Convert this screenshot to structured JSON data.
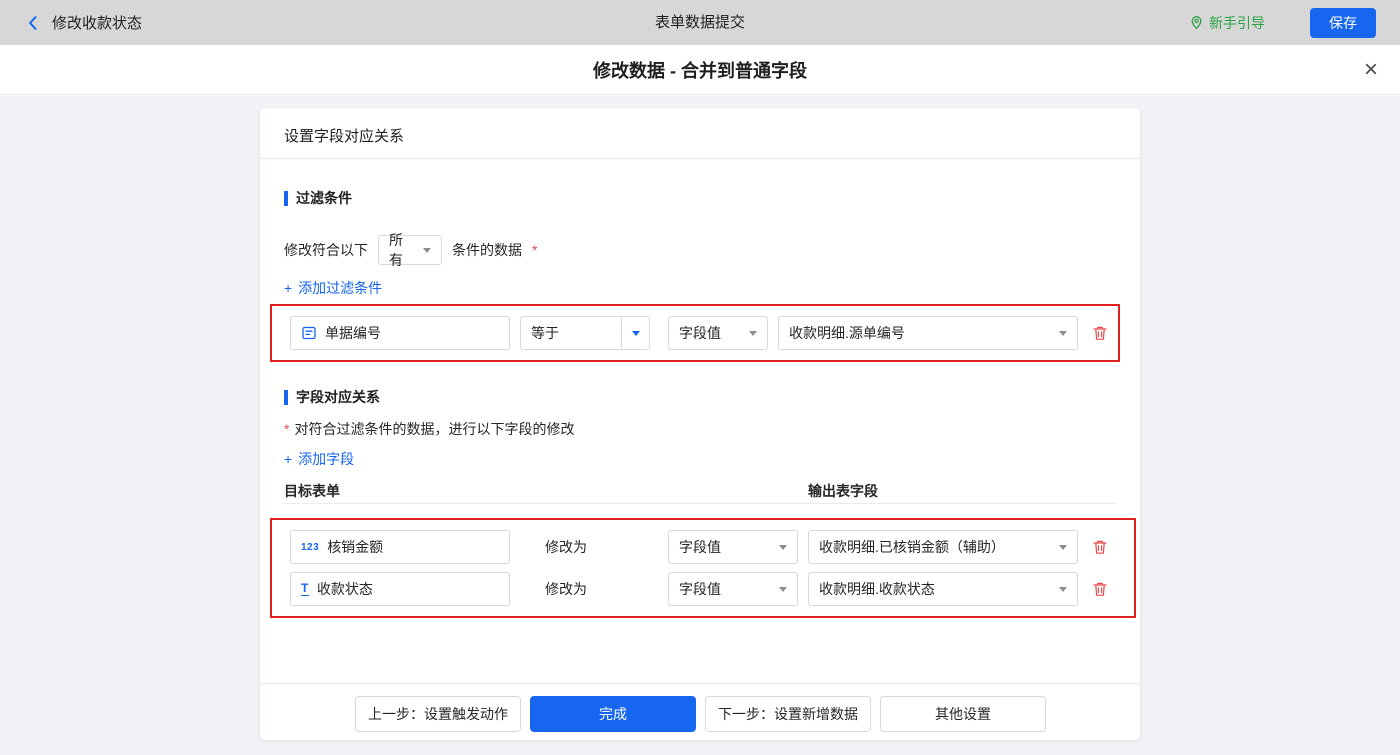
{
  "colors": {
    "accent_blue": "#1766f0",
    "annotation_red": "#e0201f",
    "danger_red": "#e5484d",
    "guide_green": "#2ba245",
    "topbar_gray": "#d7d7d7"
  },
  "icons": {
    "back": "chevron-left",
    "guide": "location-pin",
    "close": "×",
    "plus": "+",
    "delete": "trash",
    "number_field_glyph": "123",
    "text_field_glyph": "T",
    "lookup_field": "form-sheet"
  },
  "topbar": {
    "back_label": "修改收款状态",
    "title": "表单数据提交",
    "guide_label": "新手引导",
    "save_label": "保存"
  },
  "dialog": {
    "title": "修改数据 - 合并到普通字段"
  },
  "card": {
    "header": "设置字段对应关系",
    "filter": {
      "section_title": "过滤条件",
      "match_prefix": "修改符合以下",
      "match_mode": "所有",
      "match_suffix": "条件的数据",
      "required_mark": "*",
      "add_label": "添加过滤条件",
      "row": {
        "field": "单据编号",
        "operator": "等于",
        "value_type": "字段值",
        "value": "收款明细.源单编号"
      }
    },
    "mapping": {
      "section_title": "字段对应关系",
      "required_mark": "*",
      "description": "对符合过滤条件的数据，进行以下字段的修改",
      "add_label": "添加字段",
      "columns": {
        "target": "目标表单",
        "output": "输出表字段"
      },
      "action_label": "修改为",
      "rows": [
        {
          "icon": "123",
          "field": "核销金额",
          "value_type": "字段值",
          "value": "收款明细.已核销金额（辅助）"
        },
        {
          "icon": "T",
          "field": "收款状态",
          "value_type": "字段值",
          "value": "收款明细.收款状态"
        }
      ]
    },
    "footer": {
      "prev": "上一步：设置触发动作",
      "done": "完成",
      "next": "下一步：设置新增数据",
      "other": "其他设置"
    }
  }
}
